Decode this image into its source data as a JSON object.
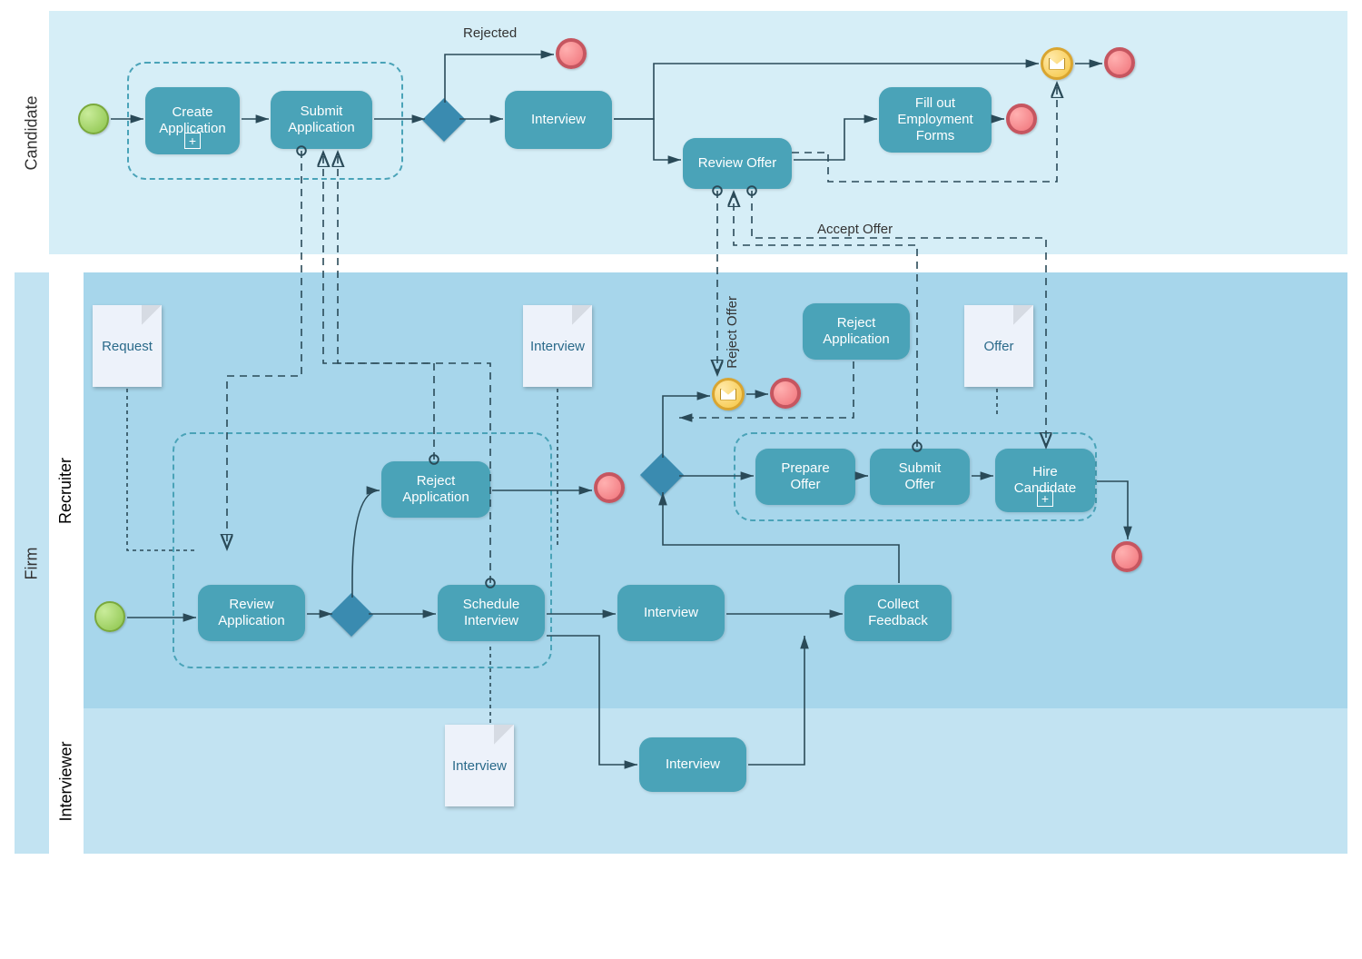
{
  "pools": {
    "candidate": {
      "label": "Candidate"
    },
    "firm": {
      "label": "Firm"
    },
    "recruiter_lane": {
      "label": "Recruiter"
    },
    "interviewer_lane": {
      "label": "Interviewer"
    }
  },
  "tasks": {
    "create_app": "Create\nApplication",
    "submit_app": "Submit\nApplication",
    "interview_c": "Interview",
    "review_offer": "Review Offer",
    "fill_forms": "Fill out\nEmployment\nForms",
    "review_app": "Review\nApplication",
    "reject_app_r": "Reject\nApplication",
    "schedule_int": "Schedule\nInterview",
    "interview_r": "Interview",
    "collect_fb": "Collect\nFeedback",
    "prepare_offer": "Prepare\nOffer",
    "submit_offer": "Submit\nOffer",
    "hire_candidate": "Hire\nCandidate",
    "reject_app_f": "Reject\nApplication",
    "interview_i": "Interview"
  },
  "labels": {
    "rejected": "Rejected",
    "accept_offer": "Accept Offer",
    "reject_offer": "Reject\nOffer"
  },
  "data_objects": {
    "request": "Request",
    "interview_top": "Interview",
    "offer": "Offer",
    "interview_bot": "Interview"
  },
  "colors": {
    "task_fill": "#4aa3b8",
    "pool_candidate": "#d6eef7",
    "pool_firm": "#a7d6eb",
    "pool_firm_header": "#c2e3f2"
  }
}
